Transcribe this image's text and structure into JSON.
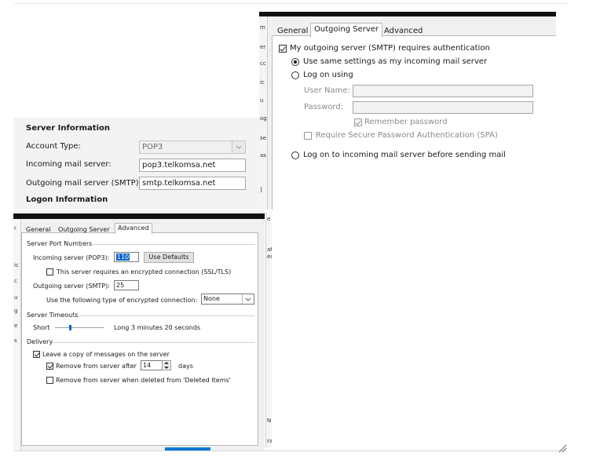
{
  "server_info": {
    "heading": "Server Information",
    "account_type_label": "Account Type:",
    "account_type_value": "POP3",
    "incoming_label": "Incoming mail server:",
    "incoming_value": "pop3.telkomsa.net",
    "outgoing_label": "Outgoing mail server (SMTP):",
    "outgoing_value": "smtp.telkomsa.net",
    "logon_heading": "Logon Information"
  },
  "outgoing_dialog": {
    "tabs": [
      "General",
      "Outgoing Server",
      "Advanced"
    ],
    "active_tab": "Outgoing Server",
    "requires_auth_label": "My outgoing server (SMTP) requires authentication",
    "requires_auth_checked": true,
    "use_same_label": "Use same settings as my incoming mail server",
    "logon_using_label": "Log on using",
    "user_name_label": "User Name:",
    "user_name_value": "",
    "password_label": "Password:",
    "password_value": "",
    "remember_password_label": "Remember password",
    "remember_password_checked": true,
    "spa_label": "Require Secure Password Authentication (SPA)",
    "spa_checked": false,
    "logon_incoming_first_label": "Log on to incoming mail server before sending mail",
    "selected_option": "use_same"
  },
  "advanced_dialog": {
    "tabs": [
      "General",
      "Outgoing Server",
      "Advanced"
    ],
    "active_tab": "Advanced",
    "port_group": "Server Port Numbers",
    "incoming_port_label": "Incoming server (POP3):",
    "incoming_port_value": "110",
    "use_defaults_label": "Use Defaults",
    "ssl_label": "This server requires an encrypted connection (SSL/TLS)",
    "ssl_checked": false,
    "outgoing_port_label": "Outgoing server (SMTP):",
    "outgoing_port_value": "25",
    "encryption_label": "Use the following type of encrypted connection:",
    "encryption_value": "None",
    "timeouts_group": "Server Timeouts",
    "timeout_short": "Short",
    "timeout_long": "Long",
    "timeout_value": "3 minutes 20 seconds",
    "timeout_slider_fraction": 0.3,
    "delivery_group": "Delivery",
    "leave_copy_label": "Leave a copy of messages on the server",
    "leave_copy_checked": true,
    "remove_after_label": "Remove from server after",
    "remove_after_checked": true,
    "remove_after_days": "14",
    "days_label": "days",
    "remove_deleted_label": "Remove from server when deleted from 'Deleted Items'",
    "remove_deleted_checked": false
  },
  "background_fragments": {
    "left_chars": [
      "r",
      "ic",
      "c",
      "u",
      "g",
      "e",
      "s"
    ],
    "right_chars": [
      "e",
      "at",
      "ec",
      "N",
      "ra"
    ],
    "top_left_chars": [
      "m",
      "er",
      "cc",
      "ic",
      "u",
      "og",
      "se",
      "as",
      "]"
    ]
  }
}
